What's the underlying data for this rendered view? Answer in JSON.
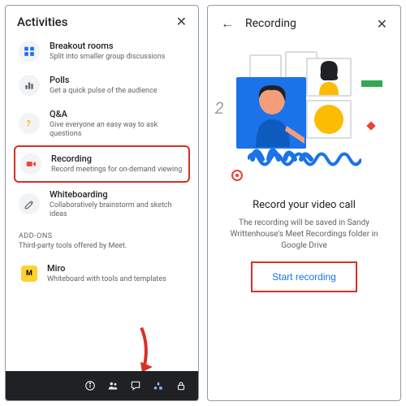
{
  "panel1": {
    "title": "Activities",
    "items": [
      {
        "title": "Breakout rooms",
        "desc": "Split into smaller group discussions"
      },
      {
        "title": "Polls",
        "desc": "Get a quick pulse of the audience"
      },
      {
        "title": "Q&A",
        "desc": "Give everyone an easy way to ask questions"
      },
      {
        "title": "Recording",
        "desc": "Record meetings for on-demand viewing"
      },
      {
        "title": "Whiteboarding",
        "desc": "Collaboratively brainstorm and sketch ideas"
      }
    ],
    "addons_header": "ADD-ONS",
    "addons_sub": "Third-party tools offered by Meet.",
    "miro": {
      "title": "Miro",
      "desc": "Whiteboard with tools and templates"
    }
  },
  "panel2": {
    "title": "Recording",
    "heading": "Record your video call",
    "desc": "The recording will be saved in Sandy Writtenhouse's Meet Recordings folder in Google Drive",
    "button": "Start recording"
  }
}
